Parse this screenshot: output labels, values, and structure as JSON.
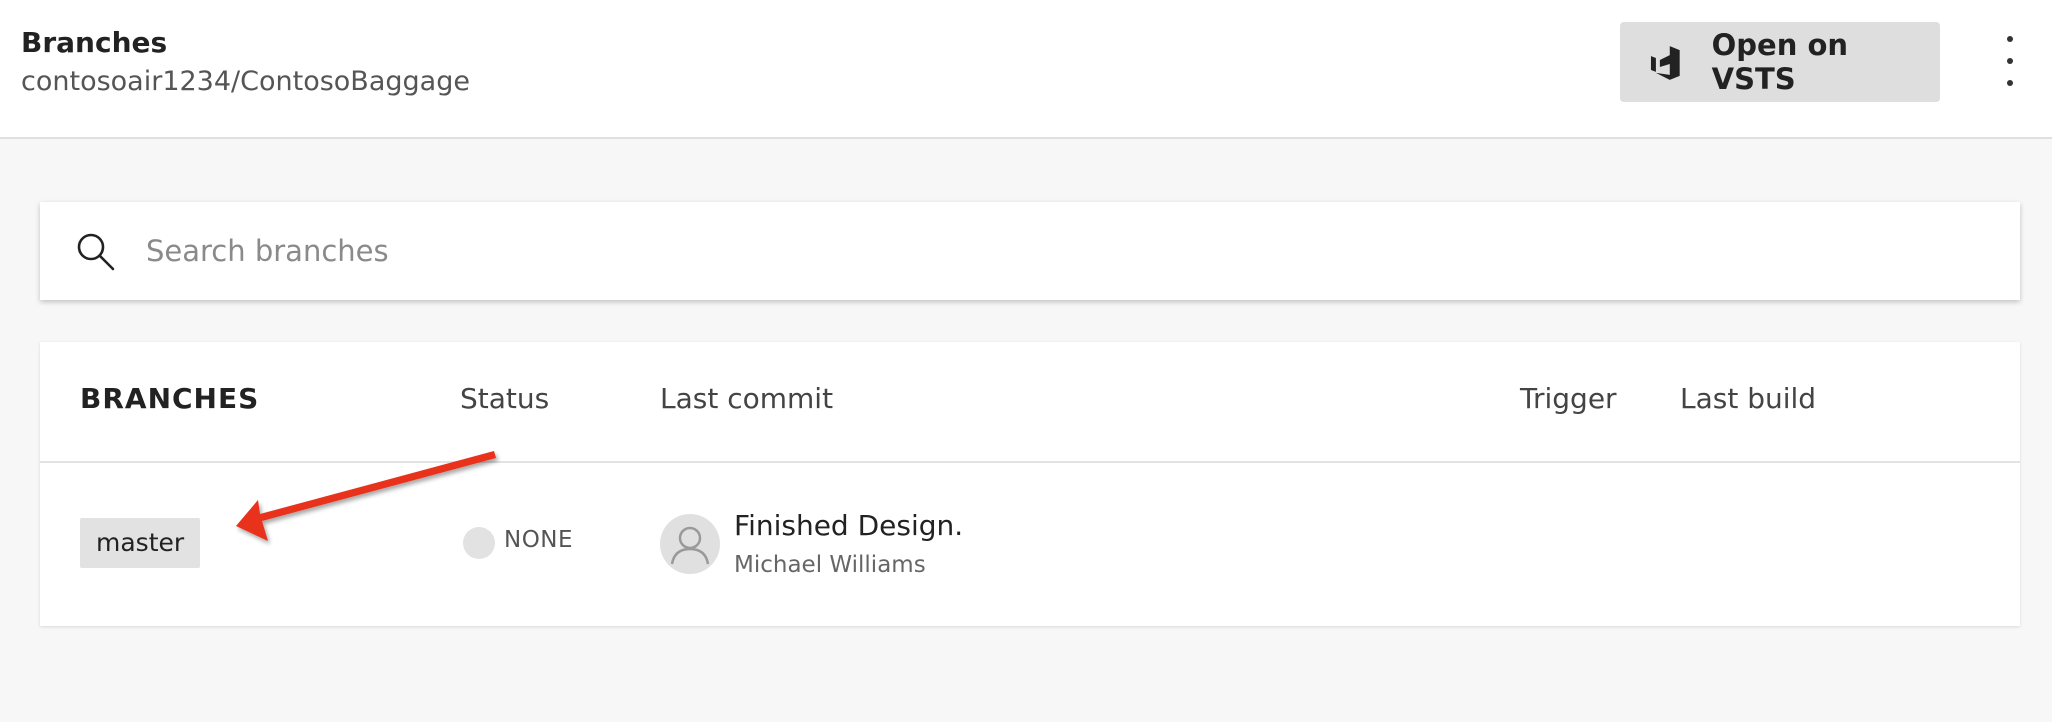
{
  "header": {
    "title": "Branches",
    "subtitle": "contosoair1234/ContosoBaggage",
    "open_button_label": "Open on VSTS",
    "open_button_icon": "vsts-icon",
    "more_icon": "more-vertical-icon"
  },
  "search": {
    "placeholder": "Search branches",
    "value": "",
    "icon": "search-icon"
  },
  "table": {
    "columns": {
      "branches": "BRANCHES",
      "status": "Status",
      "last_commit": "Last commit",
      "trigger": "Trigger",
      "last_build": "Last build"
    },
    "rows": [
      {
        "branch": "master",
        "status": "NONE",
        "commit_message": "Finished Design.",
        "commit_author": "Michael Williams",
        "trigger": "",
        "last_build": ""
      }
    ]
  },
  "annotation": {
    "color": "#e8301c",
    "points_to": "master"
  }
}
